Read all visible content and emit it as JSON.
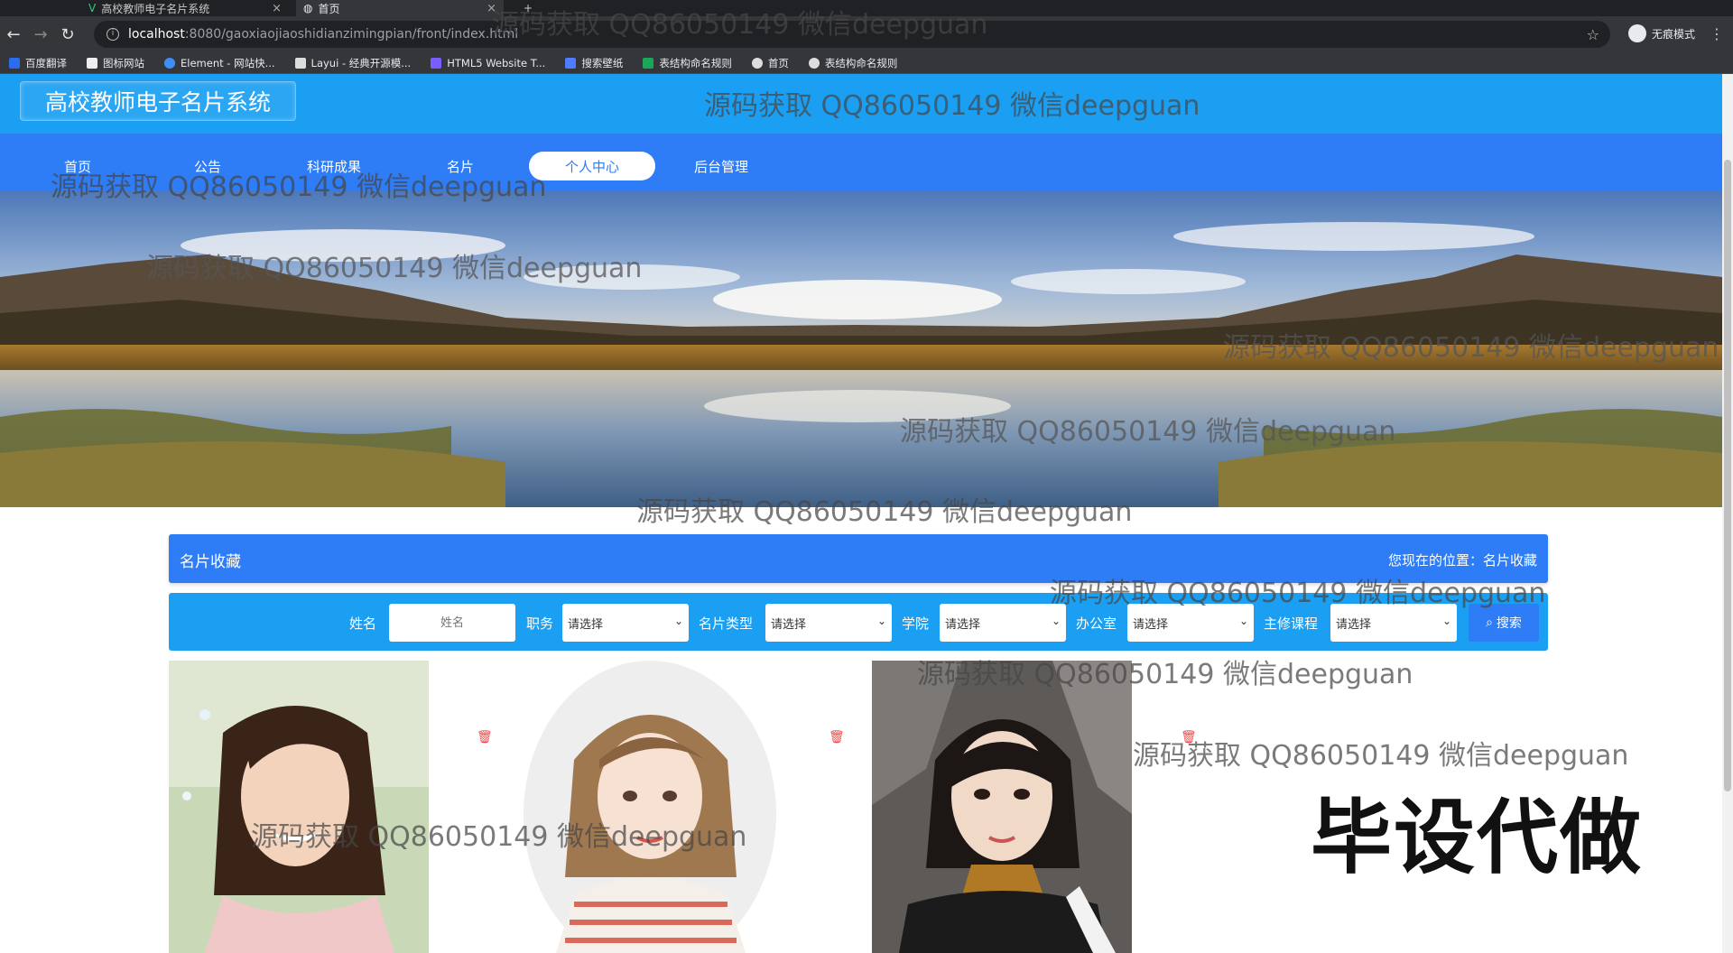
{
  "browser": {
    "tabs": [
      {
        "title": "高校教师电子名片系统",
        "active": false
      },
      {
        "title": "首页",
        "active": true
      }
    ],
    "url_host": "localhost",
    "url_path": ":8080/gaoxiaojiaoshidianzimingpian/front/index.html",
    "profile_label": "无痕模式",
    "bookmarks": [
      "百度翻译",
      "图标网站",
      "Element - 网站快...",
      "Layui - 经典开源模...",
      "HTML5 Website T...",
      "搜索壁纸",
      "表结构命名规则",
      "首页",
      "表结构命名规则"
    ]
  },
  "site": {
    "title": "高校教师电子名片系统",
    "nav": [
      "首页",
      "公告",
      "科研成果",
      "名片",
      "个人中心",
      "后台管理"
    ],
    "active_nav": "个人中心"
  },
  "banner": {
    "slides": 3,
    "active_slide": 3
  },
  "breadcrumb": {
    "title": "名片收藏",
    "location_prefix": "您现在的位置：",
    "location": "名片收藏"
  },
  "filters": {
    "name_label": "姓名",
    "name_placeholder": "姓名",
    "position_label": "职务",
    "card_type_label": "名片类型",
    "college_label": "学院",
    "office_label": "办公室",
    "course_label": "主修课程",
    "select_default": "请选择",
    "search_label": "搜索"
  },
  "watermark": "源码获取 QQ86050149 微信deepguan",
  "stamp": "毕设代做",
  "colors": {
    "header": "#1a9ff2",
    "nav": "#2e7cf6",
    "delete": "#f04848"
  }
}
